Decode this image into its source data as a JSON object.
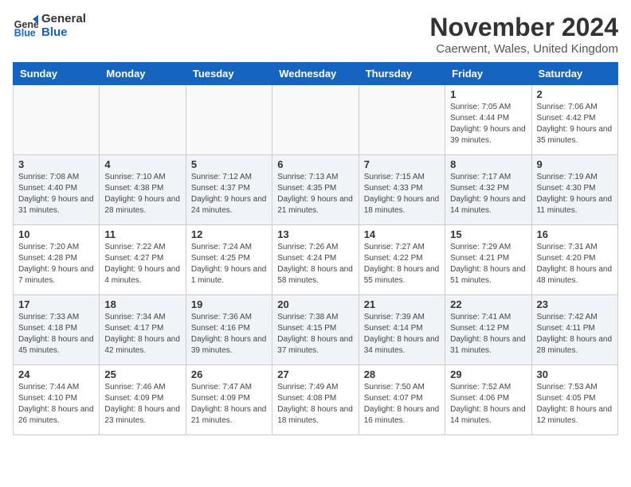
{
  "header": {
    "logo_line1": "General",
    "logo_line2": "Blue",
    "month_title": "November 2024",
    "location": "Caerwent, Wales, United Kingdom"
  },
  "days_of_week": [
    "Sunday",
    "Monday",
    "Tuesday",
    "Wednesday",
    "Thursday",
    "Friday",
    "Saturday"
  ],
  "weeks": [
    [
      {
        "day": "",
        "info": ""
      },
      {
        "day": "",
        "info": ""
      },
      {
        "day": "",
        "info": ""
      },
      {
        "day": "",
        "info": ""
      },
      {
        "day": "",
        "info": ""
      },
      {
        "day": "1",
        "info": "Sunrise: 7:05 AM\nSunset: 4:44 PM\nDaylight: 9 hours and 39 minutes."
      },
      {
        "day": "2",
        "info": "Sunrise: 7:06 AM\nSunset: 4:42 PM\nDaylight: 9 hours and 35 minutes."
      }
    ],
    [
      {
        "day": "3",
        "info": "Sunrise: 7:08 AM\nSunset: 4:40 PM\nDaylight: 9 hours and 31 minutes."
      },
      {
        "day": "4",
        "info": "Sunrise: 7:10 AM\nSunset: 4:38 PM\nDaylight: 9 hours and 28 minutes."
      },
      {
        "day": "5",
        "info": "Sunrise: 7:12 AM\nSunset: 4:37 PM\nDaylight: 9 hours and 24 minutes."
      },
      {
        "day": "6",
        "info": "Sunrise: 7:13 AM\nSunset: 4:35 PM\nDaylight: 9 hours and 21 minutes."
      },
      {
        "day": "7",
        "info": "Sunrise: 7:15 AM\nSunset: 4:33 PM\nDaylight: 9 hours and 18 minutes."
      },
      {
        "day": "8",
        "info": "Sunrise: 7:17 AM\nSunset: 4:32 PM\nDaylight: 9 hours and 14 minutes."
      },
      {
        "day": "9",
        "info": "Sunrise: 7:19 AM\nSunset: 4:30 PM\nDaylight: 9 hours and 11 minutes."
      }
    ],
    [
      {
        "day": "10",
        "info": "Sunrise: 7:20 AM\nSunset: 4:28 PM\nDaylight: 9 hours and 7 minutes."
      },
      {
        "day": "11",
        "info": "Sunrise: 7:22 AM\nSunset: 4:27 PM\nDaylight: 9 hours and 4 minutes."
      },
      {
        "day": "12",
        "info": "Sunrise: 7:24 AM\nSunset: 4:25 PM\nDaylight: 9 hours and 1 minute."
      },
      {
        "day": "13",
        "info": "Sunrise: 7:26 AM\nSunset: 4:24 PM\nDaylight: 8 hours and 58 minutes."
      },
      {
        "day": "14",
        "info": "Sunrise: 7:27 AM\nSunset: 4:22 PM\nDaylight: 8 hours and 55 minutes."
      },
      {
        "day": "15",
        "info": "Sunrise: 7:29 AM\nSunset: 4:21 PM\nDaylight: 8 hours and 51 minutes."
      },
      {
        "day": "16",
        "info": "Sunrise: 7:31 AM\nSunset: 4:20 PM\nDaylight: 8 hours and 48 minutes."
      }
    ],
    [
      {
        "day": "17",
        "info": "Sunrise: 7:33 AM\nSunset: 4:18 PM\nDaylight: 8 hours and 45 minutes."
      },
      {
        "day": "18",
        "info": "Sunrise: 7:34 AM\nSunset: 4:17 PM\nDaylight: 8 hours and 42 minutes."
      },
      {
        "day": "19",
        "info": "Sunrise: 7:36 AM\nSunset: 4:16 PM\nDaylight: 8 hours and 39 minutes."
      },
      {
        "day": "20",
        "info": "Sunrise: 7:38 AM\nSunset: 4:15 PM\nDaylight: 8 hours and 37 minutes."
      },
      {
        "day": "21",
        "info": "Sunrise: 7:39 AM\nSunset: 4:14 PM\nDaylight: 8 hours and 34 minutes."
      },
      {
        "day": "22",
        "info": "Sunrise: 7:41 AM\nSunset: 4:12 PM\nDaylight: 8 hours and 31 minutes."
      },
      {
        "day": "23",
        "info": "Sunrise: 7:42 AM\nSunset: 4:11 PM\nDaylight: 8 hours and 28 minutes."
      }
    ],
    [
      {
        "day": "24",
        "info": "Sunrise: 7:44 AM\nSunset: 4:10 PM\nDaylight: 8 hours and 26 minutes."
      },
      {
        "day": "25",
        "info": "Sunrise: 7:46 AM\nSunset: 4:09 PM\nDaylight: 8 hours and 23 minutes."
      },
      {
        "day": "26",
        "info": "Sunrise: 7:47 AM\nSunset: 4:09 PM\nDaylight: 8 hours and 21 minutes."
      },
      {
        "day": "27",
        "info": "Sunrise: 7:49 AM\nSunset: 4:08 PM\nDaylight: 8 hours and 18 minutes."
      },
      {
        "day": "28",
        "info": "Sunrise: 7:50 AM\nSunset: 4:07 PM\nDaylight: 8 hours and 16 minutes."
      },
      {
        "day": "29",
        "info": "Sunrise: 7:52 AM\nSunset: 4:06 PM\nDaylight: 8 hours and 14 minutes."
      },
      {
        "day": "30",
        "info": "Sunrise: 7:53 AM\nSunset: 4:05 PM\nDaylight: 8 hours and 12 minutes."
      }
    ]
  ]
}
